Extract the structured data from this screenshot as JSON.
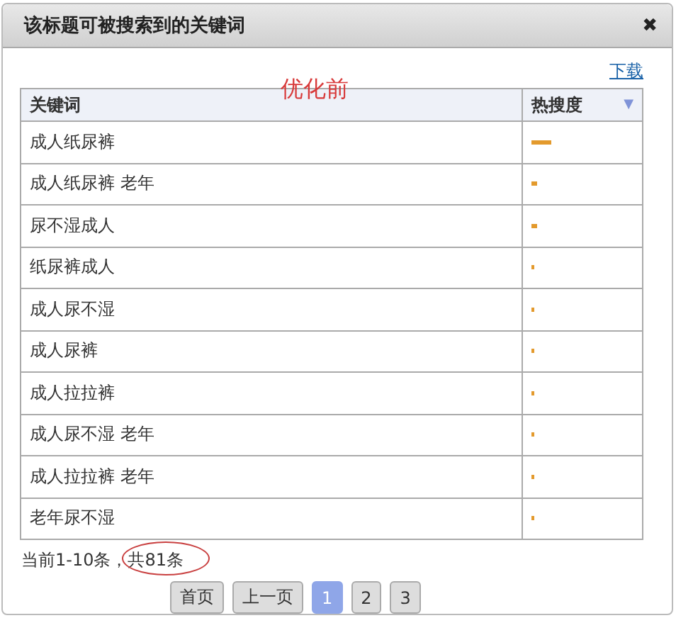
{
  "window": {
    "title": "该标题可被搜索到的关键词",
    "close": "✖"
  },
  "download_link": "下载",
  "annotation": "优化前",
  "table": {
    "columns": [
      {
        "label": "关键词"
      },
      {
        "label": "热搜度",
        "sort": "▼"
      }
    ],
    "rows": [
      {
        "keyword": "成人纸尿裤",
        "level": 0.19
      },
      {
        "keyword": "成人纸尿裤 老年",
        "level": 0.06
      },
      {
        "keyword": "尿不湿成人",
        "level": 0.06
      },
      {
        "keyword": "纸尿裤成人",
        "level": 0.025
      },
      {
        "keyword": "成人尿不湿",
        "level": 0.025
      },
      {
        "keyword": "成人尿裤",
        "level": 0.025
      },
      {
        "keyword": "成人拉拉裤",
        "level": 0.025
      },
      {
        "keyword": "成人尿不湿 老年",
        "level": 0.025
      },
      {
        "keyword": "成人拉拉裤 老年",
        "level": 0.025
      },
      {
        "keyword": "老年尿不湿",
        "level": 0.025
      }
    ]
  },
  "summary": "当前1-10条，共81条",
  "pagination": [
    {
      "label": "首页",
      "selected": false
    },
    {
      "label": "上一页",
      "selected": false
    },
    {
      "label": "1",
      "selected": true
    },
    {
      "label": "2",
      "selected": false
    },
    {
      "label": "3",
      "selected": false
    }
  ]
}
